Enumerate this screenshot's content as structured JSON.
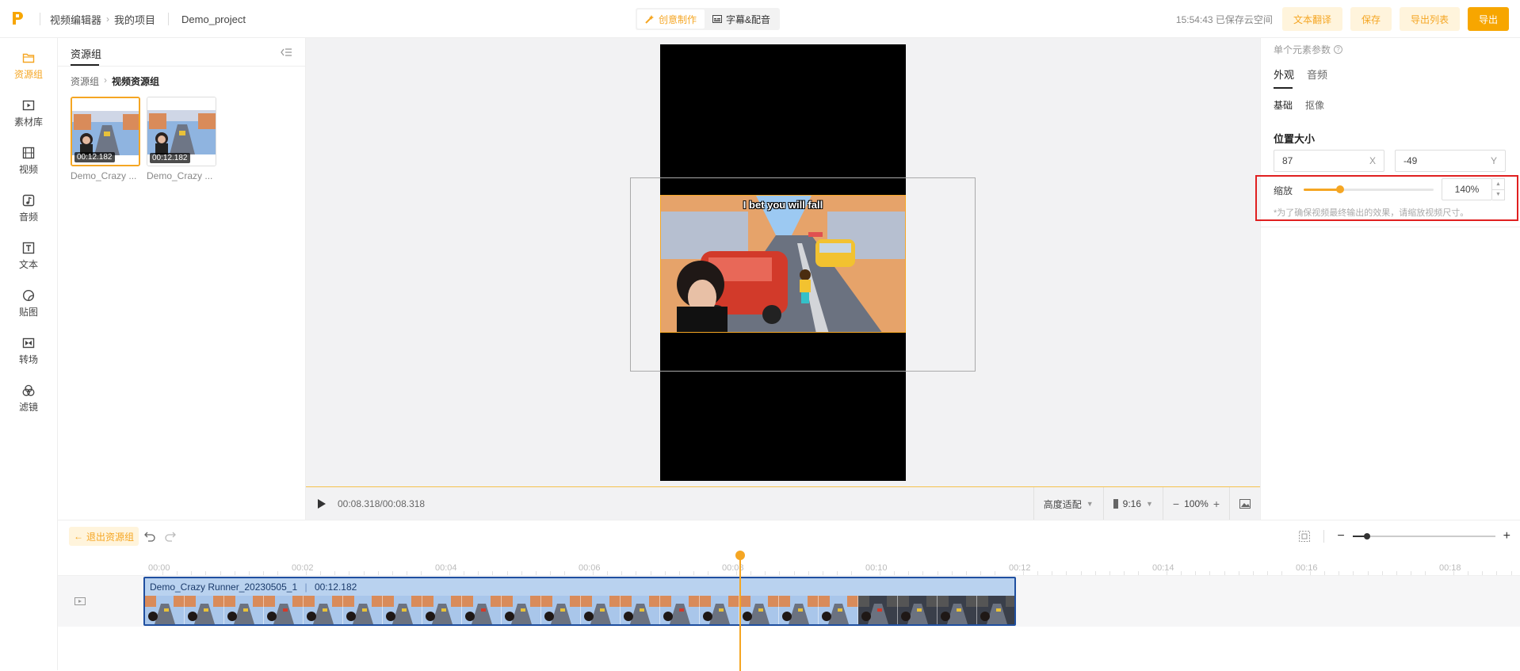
{
  "topbar": {
    "crumb_editor": "视频编辑器",
    "crumb_projects": "我的项目",
    "project_name": "Demo_project",
    "mode_creative": "创意制作",
    "mode_subtitle": "字幕&配音",
    "saved_status": "15:54:43 已保存云空间",
    "btn_translate": "文本翻译",
    "btn_save": "保存",
    "btn_export_list": "导出列表",
    "btn_export": "导出"
  },
  "leftbar": {
    "items": [
      {
        "label": "资源组",
        "icon": "folder-icon"
      },
      {
        "label": "素材库",
        "icon": "media-library-icon"
      },
      {
        "label": "视频",
        "icon": "film-icon"
      },
      {
        "label": "音频",
        "icon": "music-icon"
      },
      {
        "label": "文本",
        "icon": "text-icon"
      },
      {
        "label": "贴图",
        "icon": "sticker-icon"
      },
      {
        "label": "转场",
        "icon": "transition-icon"
      },
      {
        "label": "滤镜",
        "icon": "filter-icon"
      }
    ]
  },
  "resource": {
    "tab": "资源组",
    "crumb_root": "资源组",
    "crumb_current": "视频资源组",
    "items": [
      {
        "duration": "00:12.182",
        "name": "Demo_Crazy ..."
      },
      {
        "duration": "00:12.182",
        "name": "Demo_Crazy ..."
      }
    ]
  },
  "preview": {
    "caption": "I bet you will fall",
    "time": "00:08.318/00:08.318",
    "fit_mode": "高度适配",
    "ratio": "9:16",
    "zoom": "100%"
  },
  "props": {
    "title": "单个元素参数",
    "tab_appearance": "外观",
    "tab_audio": "音频",
    "sub_basic": "基础",
    "sub_keying": "抠像",
    "section_position": "位置大小",
    "pos_x": "87",
    "pos_x_axis": "X",
    "pos_y": "-49",
    "pos_y_axis": "Y",
    "scale_label": "缩放",
    "scale_value": "140%",
    "scale_fraction": 0.28,
    "scale_note": "*为了确保视频最终输出的效果，请缩放视频尺寸。"
  },
  "timeline": {
    "exit_label": "退出资源组",
    "ticks": [
      "00:00",
      "00:02",
      "00:04",
      "00:06",
      "00:08",
      "00:10",
      "00:12",
      "00:14",
      "00:16",
      "00:18"
    ],
    "clip_name": "Demo_Crazy Runner_20230505_1",
    "clip_duration": "00:12.182",
    "zoom_fraction": 0.1
  },
  "colors": {
    "accent": "#f5a623",
    "clip_border": "#1f4fa0",
    "highlight": "#e02020"
  }
}
